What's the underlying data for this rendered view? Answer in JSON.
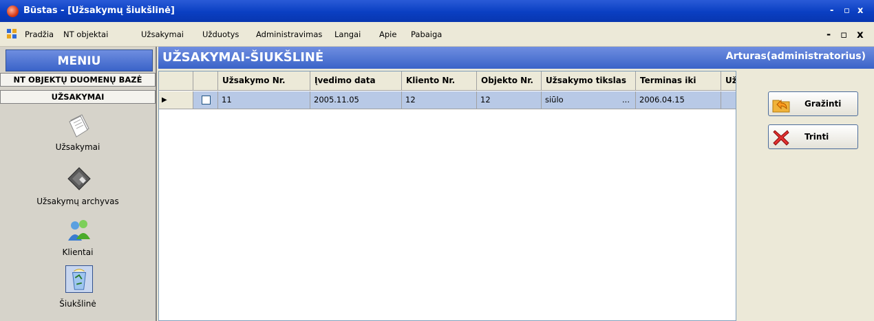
{
  "window": {
    "title": "Būstas - [Užsakymų šiukšlinė]",
    "controls": [
      "-",
      "▫",
      "x"
    ]
  },
  "menubar": {
    "items": [
      "Pradžia",
      "NT objektai",
      "Užsakymai",
      "Užduotys",
      "Administravimas",
      "Langai",
      "Apie",
      "Pabaiga"
    ],
    "mdi_controls": [
      "-",
      "▫",
      "x"
    ]
  },
  "sidebar": {
    "header": "MENIU",
    "sections": [
      "NT OBJEKTŲ DUOMENŲ BAZĖ",
      "UŽSAKYMAI"
    ],
    "items": [
      {
        "label": "Užsakymai",
        "icon": "document-icon"
      },
      {
        "label": "Užsakymų archyvas",
        "icon": "archive-disk-icon"
      },
      {
        "label": "Klientai",
        "icon": "users-icon"
      },
      {
        "label": "Šiukšlinė",
        "icon": "recycle-bin-icon"
      }
    ]
  },
  "content": {
    "title": "UŽSAKYMAI-ŠIUKŠLINĖ",
    "user": "Arturas(administratorius)"
  },
  "grid": {
    "columns": [
      "",
      "",
      "Užsakymo Nr.",
      "Įvedimo data",
      "Kliento Nr.",
      "Objekto Nr.",
      "Užsakymo tikslas",
      "Terminas iki",
      "Už"
    ],
    "rows": [
      {
        "indicator": "▶",
        "checked": false,
        "cells": [
          "11",
          "2005.11.05",
          "12",
          "12",
          "siūlo",
          "2006.04.15",
          ""
        ],
        "ellipsis": "..."
      }
    ]
  },
  "actions": {
    "restore_label": "Gražinti",
    "delete_label": "Trinti"
  },
  "colors": {
    "titlebar": "#0a3fc2",
    "header_gradient": "#3a63c8",
    "selected_row": "#b8c9e6",
    "delete_icon": "#e03030"
  }
}
